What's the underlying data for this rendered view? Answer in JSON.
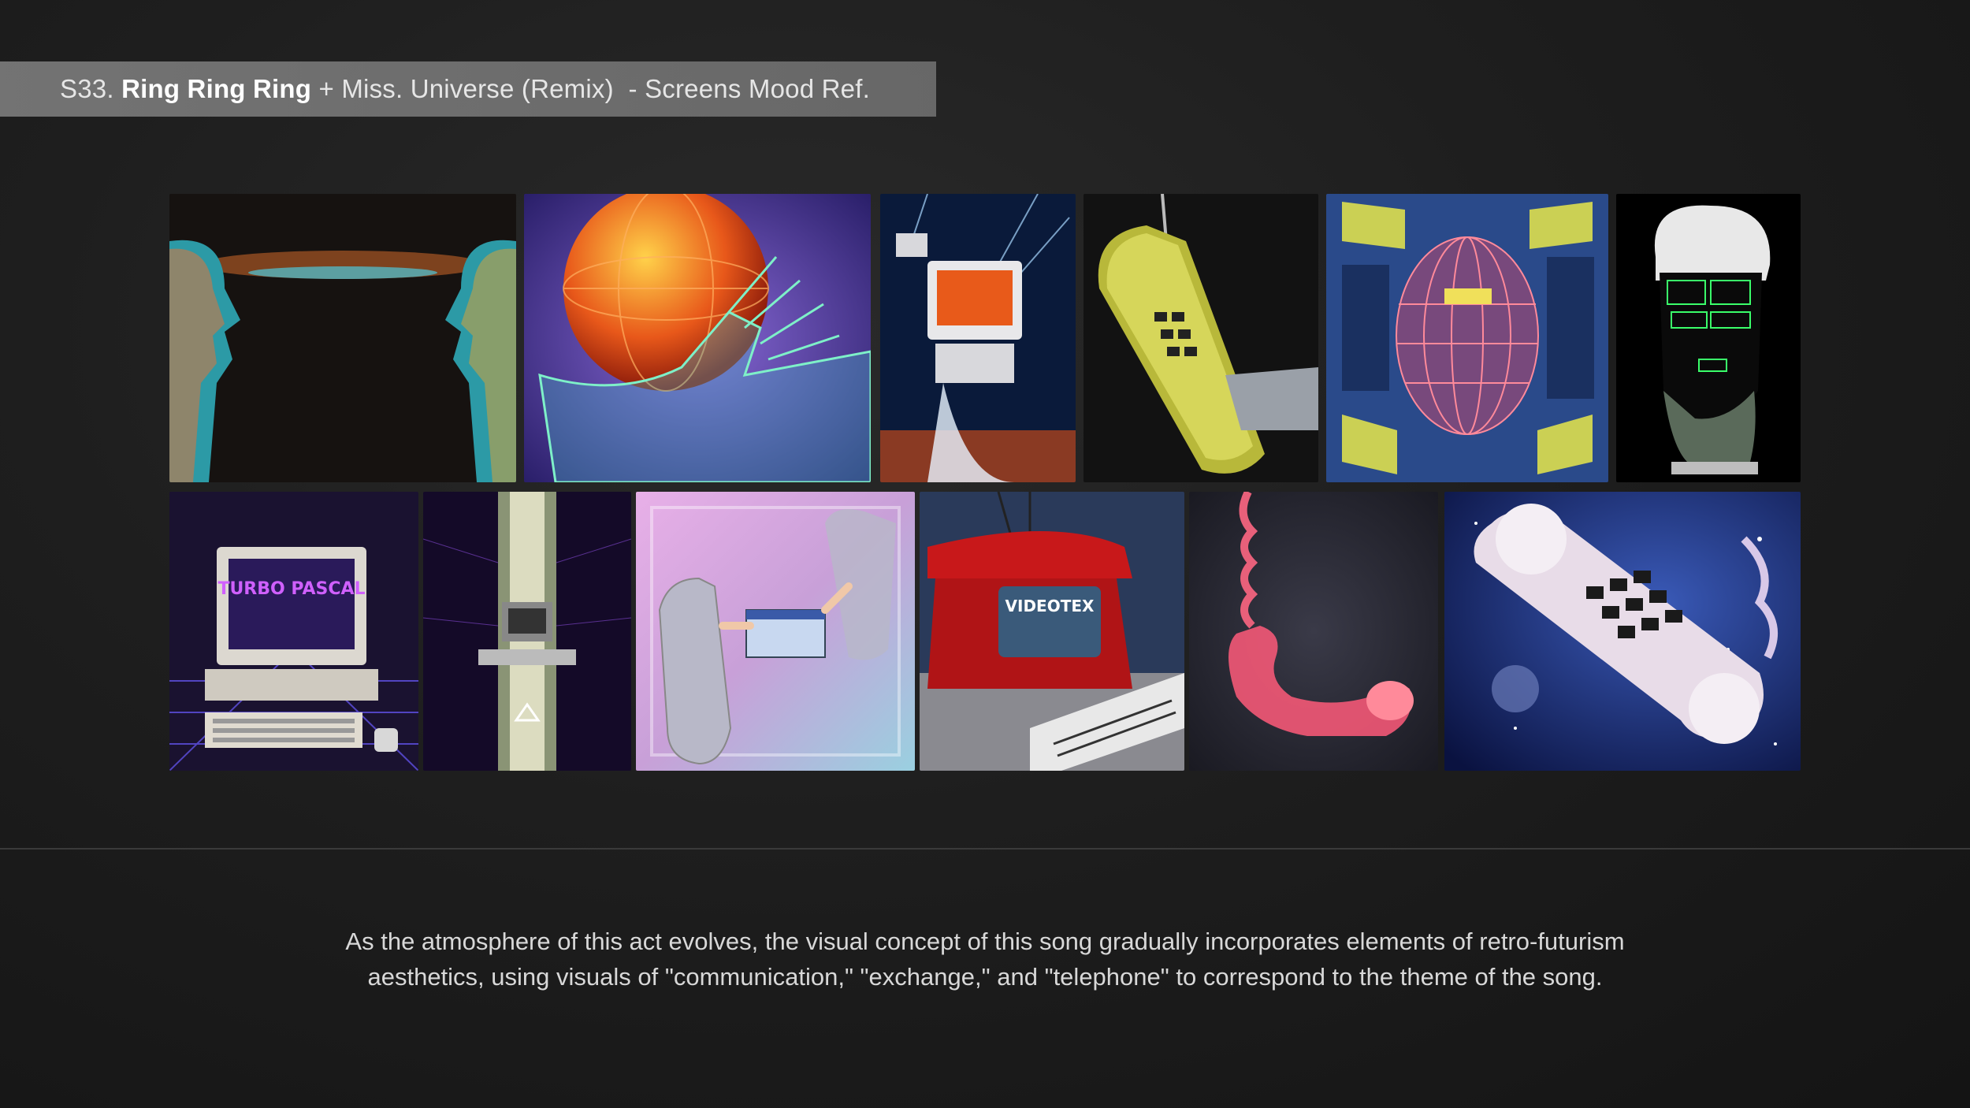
{
  "header": {
    "prefix": "S33. ",
    "song_title": "Ring Ring Ring",
    "suffix": " + Miss. Universe (Remix)  - Screens Mood Ref."
  },
  "caption": {
    "line1": "As the atmosphere of this act evolves, the visual concept of this song gradually incorporates elements of retro-futurism",
    "line2": "aesthetics, using visuals of \"communication,\" \"exchange,\" and \"telephone\" to correspond to the theme of the song."
  },
  "tiles": {
    "computer_screen_text": "TURBO PASCAL",
    "terminal_screen_text": "VIDEOTEX"
  },
  "colors": {
    "background": "#1e1e1e",
    "title_bar": "#828282",
    "caption_text": "#d8d8d8"
  }
}
